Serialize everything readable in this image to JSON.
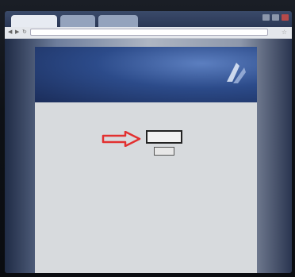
{
  "browser": {
    "tabs": [
      "",
      "",
      ""
    ],
    "address": "",
    "icons": {
      "back": "back-arrow-icon",
      "forward": "forward-arrow-icon",
      "reload": "reload-icon",
      "bookmark": "star-icon"
    }
  },
  "banner": {
    "title": "",
    "subtitle": ""
  },
  "form": {
    "label_top": "",
    "label_side": "",
    "input_value": "",
    "button_label": ""
  },
  "footer": {
    "note": ""
  },
  "colors": {
    "banner_dark": "#1b2d5a",
    "banner_light": "#5c7fc0",
    "arrow": "#e23030",
    "page_bg": "#d7dadd"
  }
}
